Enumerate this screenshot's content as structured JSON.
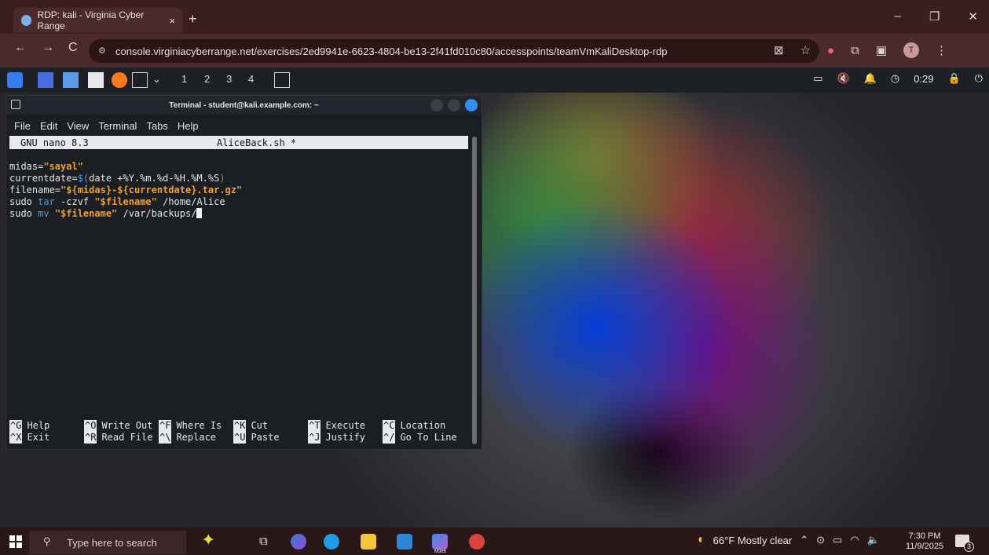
{
  "browser": {
    "tab_title": "RDP: kali - Virginia Cyber Range",
    "tab_close": "×",
    "new_tab": "+",
    "url": "console.virginiacyberrange.net/exercises/2ed9941e-6623-4804-be13-2f41fd010c80/accesspoints/teamVmKaliDesktop-rdp",
    "avatar_letter": "T",
    "back": "←",
    "forward": "→",
    "reload": "C"
  },
  "kali_panel": {
    "workspaces": [
      "1",
      "2",
      "3",
      "4"
    ],
    "clock": "0:29"
  },
  "terminal": {
    "title": "Terminal - student@kali.example.com: ~",
    "menu": [
      "File",
      "Edit",
      "View",
      "Terminal",
      "Tabs",
      "Help"
    ],
    "nano_version": "GNU nano 8.3",
    "filename": "AliceBack.sh *",
    "lines": [
      {
        "a": "midas=",
        "s": "\"sayal\"",
        "b": ""
      },
      {
        "a": "currentdate=",
        "k": "$(",
        "b": "date +%Y.%m.%d-%H.%M.%S",
        "k2": ")"
      },
      {
        "a": "filename=",
        "s": "\"${midas}-${currentdate}.tar.gz\""
      },
      {
        "a": "sudo ",
        "k": "tar",
        "b": " -czvf ",
        "s": "\"$filename\"",
        "c": " /home/Alice"
      },
      {
        "a": "sudo ",
        "k": "mv",
        "b": " ",
        "s": "\"$filename\"",
        "c": " /var/backups/"
      }
    ],
    "shortcuts": [
      [
        {
          "key": "^G",
          "label": "Help"
        },
        {
          "key": "^O",
          "label": "Write Out"
        },
        {
          "key": "^F",
          "label": "Where Is"
        },
        {
          "key": "^K",
          "label": "Cut"
        },
        {
          "key": "^T",
          "label": "Execute"
        },
        {
          "key": "^C",
          "label": "Location"
        }
      ],
      [
        {
          "key": "^X",
          "label": "Exit"
        },
        {
          "key": "^R",
          "label": "Read File"
        },
        {
          "key": "^\\",
          "label": "Replace"
        },
        {
          "key": "^U",
          "label": "Paste"
        },
        {
          "key": "^J",
          "label": "Justify"
        },
        {
          "key": "^/",
          "label": "Go To Line"
        }
      ]
    ]
  },
  "taskbar": {
    "search_placeholder": "Type here to search",
    "weather": "66°F  Mostly clear",
    "time": "7:30 PM",
    "date": "11/9/2025",
    "m365_label": "M365",
    "notification_count": "3"
  }
}
